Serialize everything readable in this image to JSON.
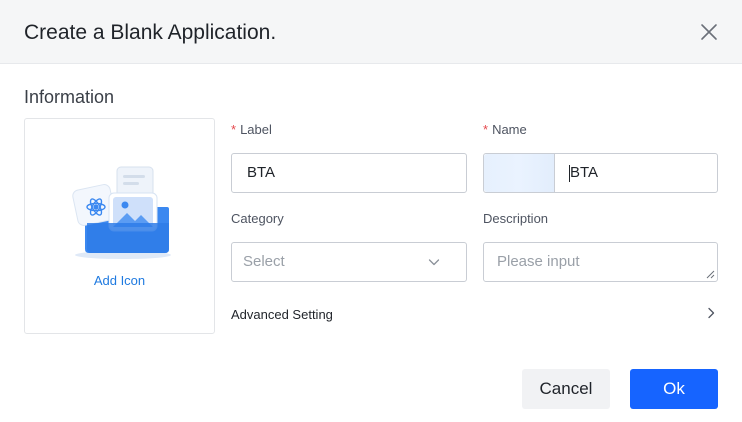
{
  "dialog": {
    "title": "Create a Blank Application."
  },
  "information": {
    "section_title": "Information",
    "add_icon_label": "Add Icon"
  },
  "form": {
    "label": {
      "required_mark": "*",
      "caption": "Label",
      "value": "BTA"
    },
    "name": {
      "required_mark": "*",
      "caption": "Name",
      "value": "BTA"
    },
    "category": {
      "caption": "Category",
      "placeholder": "Select"
    },
    "description": {
      "caption": "Description",
      "placeholder": "Please input"
    },
    "advanced_setting": "Advanced Setting"
  },
  "buttons": {
    "cancel": "Cancel",
    "ok": "Ok"
  },
  "colors": {
    "primary": "#1664ff",
    "required": "#e5484d",
    "link": "#1f7ae0"
  },
  "icons": {
    "close": "close-icon",
    "chevron_down": "chevron-down-icon",
    "chevron_right": "chevron-right-icon",
    "illustration": "folder-illustration-icon"
  }
}
